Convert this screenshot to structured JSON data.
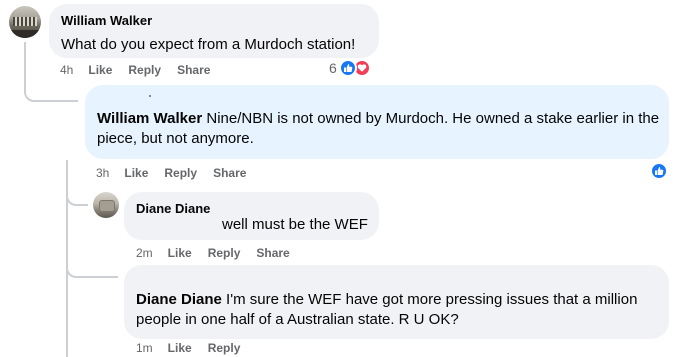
{
  "comments": [
    {
      "author": "William Walker",
      "text": "What do you expect from a Murdoch station!",
      "time": "4h",
      "actions": [
        "Like",
        "Reply",
        "Share"
      ],
      "reaction_count": "6",
      "reactions": [
        "like-icon",
        "love-icon"
      ]
    },
    {
      "author": "William Walker",
      "text": " Nine/NBN is not owned by Murdoch. He owned a stake earlier in the piece, but not anymore.",
      "time": "3h",
      "actions": [
        "Like",
        "Reply",
        "Share"
      ],
      "reactions": [
        "like-icon"
      ]
    },
    {
      "author": "Diane Diane",
      "text": "well must be the WEF",
      "time": "2m",
      "actions": [
        "Like",
        "Reply",
        "Share"
      ]
    },
    {
      "author": "Diane Diane",
      "text": " I'm sure the WEF have got more pressing issues that a million people in one half of a Australian state. R U OK?",
      "time": "1m",
      "actions": [
        "Like",
        "Reply"
      ]
    }
  ],
  "colors": {
    "bubble": "#f0f2f5",
    "bubble_highlight": "#e7f3ff",
    "like_blue": "#1877f2",
    "love_red": "#f33e58",
    "meta_gray": "#65676b"
  }
}
